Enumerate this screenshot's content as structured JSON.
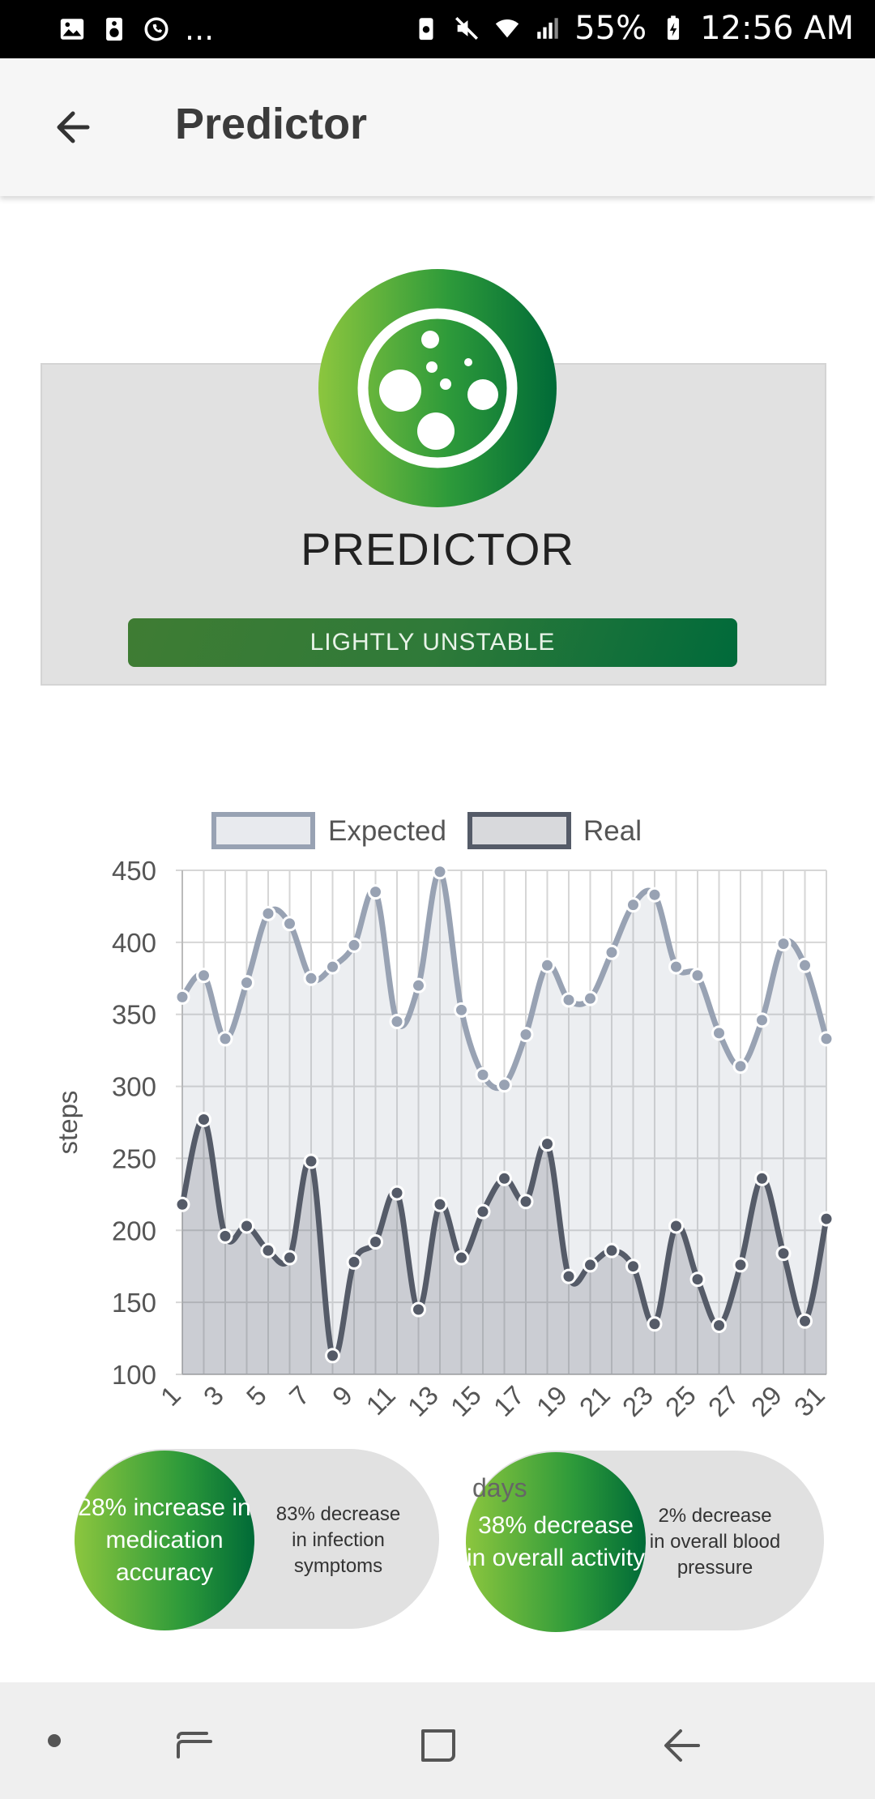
{
  "status_bar": {
    "battery": "55%",
    "time": "12:56 AM",
    "overflow": "..."
  },
  "app_bar": {
    "title": "Predictor"
  },
  "card": {
    "title": "PREDICTOR",
    "status": "LIGHTLY UNSTABLE"
  },
  "stats": [
    {
      "main": "28% increase in medication accuracy",
      "side": "83% decrease in infection symptoms"
    },
    {
      "main": "38% decrease in overall activity",
      "side": "2% decrease in overall blood pressure"
    }
  ],
  "colors": {
    "green_light": "#8cc63e",
    "green_dark": "#006a37",
    "expected_line": "#98a2b3",
    "real_line": "#555b68"
  },
  "chart_data": {
    "type": "line",
    "xlabel": "days",
    "ylabel": "steps",
    "x": [
      1,
      2,
      3,
      4,
      5,
      6,
      7,
      8,
      9,
      10,
      11,
      12,
      13,
      14,
      15,
      16,
      17,
      18,
      19,
      20,
      21,
      22,
      23,
      24,
      25,
      26,
      27,
      28,
      29,
      30,
      31
    ],
    "x_ticks": [
      "1",
      "3",
      "5",
      "7",
      "9",
      "11",
      "13",
      "15",
      "17",
      "19",
      "21",
      "23",
      "25",
      "27",
      "29",
      "31"
    ],
    "ylim": [
      100,
      450
    ],
    "y_ticks": [
      100,
      150,
      200,
      250,
      300,
      350,
      400,
      450
    ],
    "legend_position": "top",
    "grid": true,
    "series": [
      {
        "name": "Expected",
        "values": [
          362,
          377,
          333,
          372,
          420,
          413,
          375,
          383,
          398,
          435,
          345,
          370,
          449,
          353,
          308,
          301,
          336,
          384,
          360,
          361,
          393,
          426,
          433,
          383,
          377,
          337,
          314,
          346,
          399,
          384,
          333
        ]
      },
      {
        "name": "Real",
        "values": [
          218,
          277,
          196,
          203,
          186,
          181,
          248,
          113,
          178,
          192,
          226,
          145,
          218,
          181,
          213,
          236,
          220,
          260,
          168,
          176,
          186,
          175,
          135,
          203,
          166,
          134,
          176,
          236,
          184,
          137,
          208
        ]
      }
    ]
  }
}
